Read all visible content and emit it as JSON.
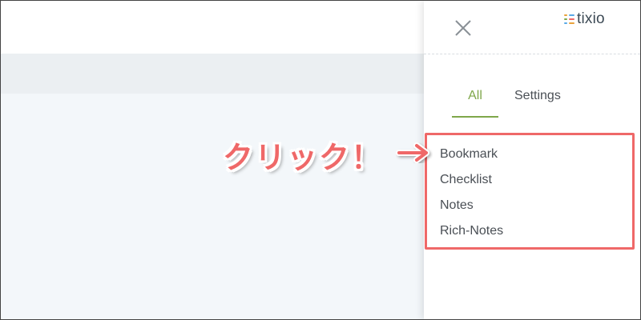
{
  "panel": {
    "logo_text": "tixio",
    "tabs": [
      {
        "label": "All",
        "active": true
      },
      {
        "label": "Settings",
        "active": false
      }
    ],
    "items": [
      {
        "label": "Bookmark"
      },
      {
        "label": "Checklist"
      },
      {
        "label": "Notes"
      },
      {
        "label": "Rich-Notes"
      }
    ]
  },
  "annotation": {
    "text": "クリック！",
    "arrow_icon": "right-arrow-icon"
  },
  "colors": {
    "accent_green": "#7fa74a",
    "highlight_red": "#ef6868",
    "text": "#4a4f55",
    "band": "#ebeff2",
    "body_bg": "#f3f7fa"
  },
  "icons": {
    "close": "close-icon",
    "logo_mark": "tixio-logo-icon"
  }
}
